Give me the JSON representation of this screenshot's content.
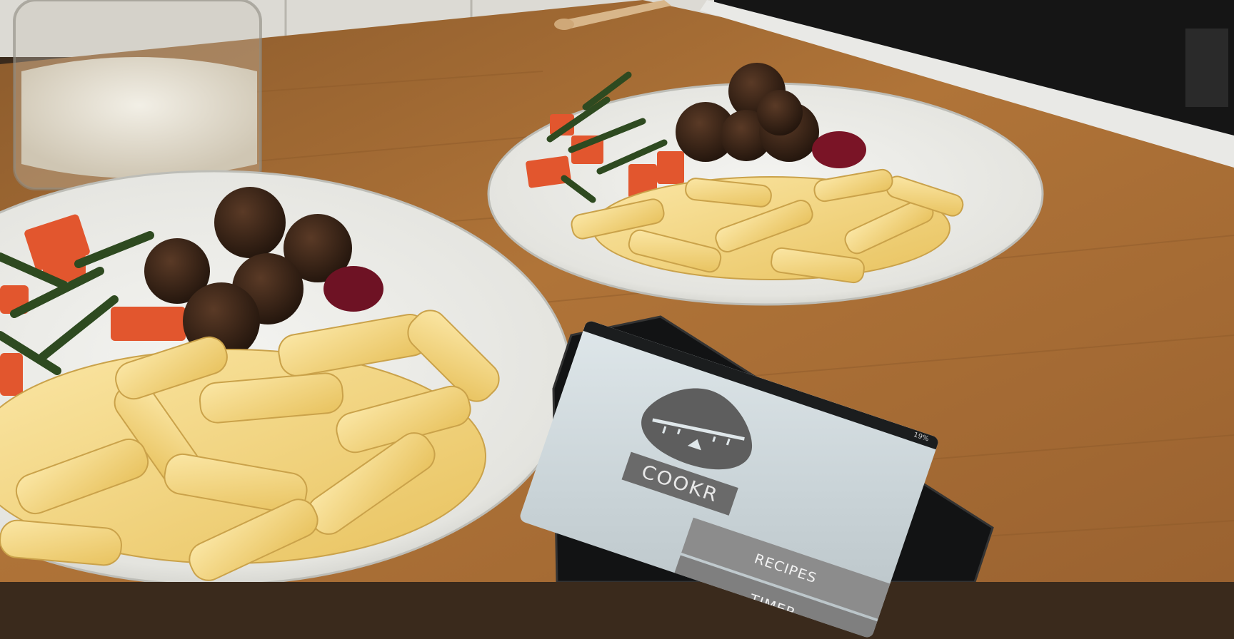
{
  "phone_app": {
    "status_text": "19%",
    "brand": "COOKR",
    "menu": [
      {
        "label": "RECIPES"
      },
      {
        "label": "TIMER"
      }
    ]
  },
  "colors": {
    "countertop": "#b7793c",
    "plate": "#eeeeea",
    "pasta": "#f0d27a",
    "meatball": "#3a2418",
    "tomato": "#e2562e",
    "arugula": "#2e4a20",
    "phone_screen": "#dfe7ea",
    "phone_button": "#8c8c8c"
  },
  "objects": [
    {
      "name": "rice-jar"
    },
    {
      "name": "plate-front"
    },
    {
      "name": "plate-back"
    },
    {
      "name": "smartphone"
    },
    {
      "name": "stove"
    }
  ]
}
